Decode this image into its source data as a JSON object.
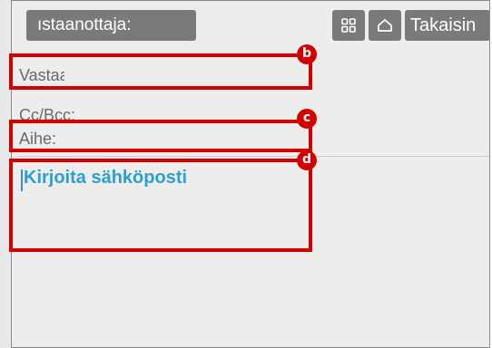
{
  "toolbar": {
    "recipient_label": "ıstaanottaja:",
    "grid_icon": "grid-icon",
    "home_icon": "home-icon",
    "back_label": "Takaisin"
  },
  "fields": {
    "to_label": "Vastaanottaja:",
    "cc_bcc_label": "Cc/Bcc:",
    "subject_label": "Aihe:"
  },
  "body": {
    "placeholder": "Kirjoita sähköposti"
  },
  "callouts": {
    "b": "b",
    "c": "c",
    "d": "d"
  },
  "colors": {
    "callout": "#d40000",
    "toolbar_button": "#7a7a7a",
    "placeholder_text": "#2aa0d2"
  }
}
